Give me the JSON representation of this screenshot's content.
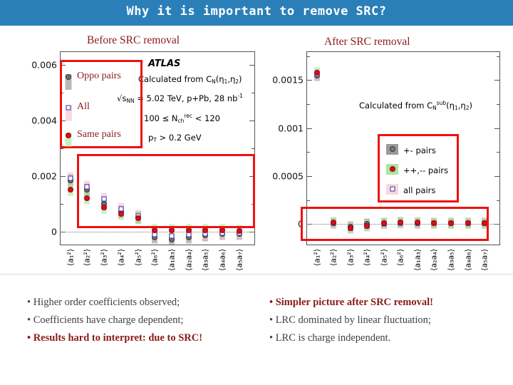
{
  "title": "Why it is important to remove SRC?",
  "headings": {
    "left": "Before SRC removal",
    "right": "After SRC removal"
  },
  "colors": {
    "title_bar": "#2b7fb8",
    "heading": "#8b1a1a",
    "highlight_box": "#ee1111",
    "marker_red": "#d80d1e",
    "marker_grey": "#6e6e6e",
    "marker_blue_open": "#3b2fb0",
    "bullet_text": "#404040",
    "bullet_red": "#8b1a1a"
  },
  "left_panel": {
    "annotation": {
      "experiment": "ATLAS",
      "line1": "Calculated from C_N(η_1,η_2)",
      "line2": "√s_NN = 5.02 TeV, p+Pb, 28 nb^-1",
      "line3": "100 ≤ N_ch^rec < 120",
      "line4": "p_T > 0.2 GeV"
    },
    "overlay_labels": [
      {
        "text": "Oppo pairs",
        "marker": "circ-grey"
      },
      {
        "text": "All",
        "marker": "sq-open"
      },
      {
        "text": "Same pairs",
        "marker": "circ-red"
      }
    ]
  },
  "right_panel": {
    "annotation": {
      "line1": "Calculated from C_N^sub(η_1,η_2)"
    },
    "legend": [
      {
        "label": "+- pairs",
        "marker": "circ-grey",
        "swatch": "#9a9a9a"
      },
      {
        "label": "++,-- pairs",
        "marker": "circ-red",
        "swatch": "#a8e6a0"
      },
      {
        "label": "all pairs",
        "marker": "sq-open",
        "swatch": "#f8d7dc"
      }
    ]
  },
  "bullets": {
    "left": [
      {
        "text": "Higher order coefficients observed;",
        "emphasis": false
      },
      {
        "text": "Coefficients have charge dependent;",
        "emphasis": false
      },
      {
        "text": "Results hard to interpret: due to SRC!",
        "emphasis": true
      }
    ],
    "right": [
      {
        "text": "Simpler picture after SRC removal!",
        "emphasis": true
      },
      {
        "text": "LRC dominated by linear fluctuation;",
        "emphasis": false
      },
      {
        "text": "LRC is charge independent.",
        "emphasis": false
      }
    ]
  },
  "chart_data": [
    {
      "type": "scatter",
      "id": "before-src-removal",
      "title": "Before SRC removal",
      "xlabel": "",
      "ylabel": "",
      "ylim": [
        -0.0005,
        0.0065
      ],
      "yticks": [
        0,
        0.002,
        0.004,
        0.006
      ],
      "ytick_labels": [
        "0",
        "0.002",
        "0.004",
        "0.006"
      ],
      "grid": false,
      "zero_line": true,
      "legend_position": "upper-left",
      "categories": [
        "⟨a₁²⟩",
        "⟨a₂²⟩",
        "⟨a₃²⟩",
        "⟨a₄²⟩",
        "⟨a₅²⟩",
        "⟨a₆²⟩",
        "⟨a₁a₃⟩",
        "⟨a₂a₄⟩",
        "⟨a₃a₅⟩",
        "⟨a₄a₆⟩",
        "⟨a₅a₇⟩"
      ],
      "series": [
        {
          "name": "Oppo pairs",
          "marker": "circ-grey",
          "values": [
            0.00185,
            0.0015,
            0.001,
            0.00072,
            0.0005,
            -0.00022,
            -0.0003,
            -0.00022,
            -0.00014,
            -0.0001,
            -8e-05
          ]
        },
        {
          "name": "All",
          "marker": "sq-open",
          "values": [
            0.00192,
            0.00162,
            0.00118,
            0.0008,
            0.00055,
            -0.00012,
            -0.00016,
            -0.00012,
            -8e-05,
            -6e-05,
            -5e-05
          ]
        },
        {
          "name": "Same pairs",
          "marker": "circ-red",
          "values": [
            0.0015,
            0.0012,
            0.00086,
            0.00064,
            0.00048,
            4e-05,
            4e-05,
            4e-05,
            4e-05,
            4e-05,
            2e-05
          ]
        }
      ]
    },
    {
      "type": "scatter",
      "id": "after-src-removal",
      "title": "After SRC removal",
      "xlabel": "",
      "ylabel": "",
      "ylim": [
        -0.00022,
        0.0018
      ],
      "yticks": [
        0,
        0.0005,
        0.001,
        0.0015
      ],
      "ytick_labels": [
        "0",
        "0.0005",
        "0.001",
        "0.0015"
      ],
      "grid": false,
      "zero_line": true,
      "legend_position": "middle-right",
      "categories": [
        "⟨a₁²⟩",
        "⟨a₂²⟩",
        "⟨a₃²⟩",
        "⟨a₄²⟩",
        "⟨a₅²⟩",
        "⟨a₆²⟩",
        "⟨a₁a₃⟩",
        "⟨a₂a₄⟩",
        "⟨a₃a₅⟩",
        "⟨a₄a₆⟩",
        "⟨a₅a₇⟩"
      ],
      "series": [
        {
          "name": "+- pairs",
          "marker": "circ-grey",
          "values": [
            0.00155,
            1e-05,
            -3e-05,
            0.0,
            1e-05,
            2e-05,
            1e-05,
            1e-05,
            1e-05,
            1e-05,
            1e-05
          ]
        },
        {
          "name": "++,-- pairs",
          "marker": "circ-red",
          "values": [
            0.00158,
            2e-05,
            -4e-05,
            -2e-05,
            1e-05,
            2e-05,
            2e-05,
            1e-05,
            1e-05,
            1e-05,
            1e-05
          ]
        },
        {
          "name": "all pairs",
          "marker": "sq-open",
          "values": [
            0.00156,
            1e-05,
            -4e-05,
            -2e-05,
            0.0,
            1e-05,
            1e-05,
            1e-05,
            1e-05,
            1e-05,
            1e-05
          ]
        }
      ]
    }
  ]
}
